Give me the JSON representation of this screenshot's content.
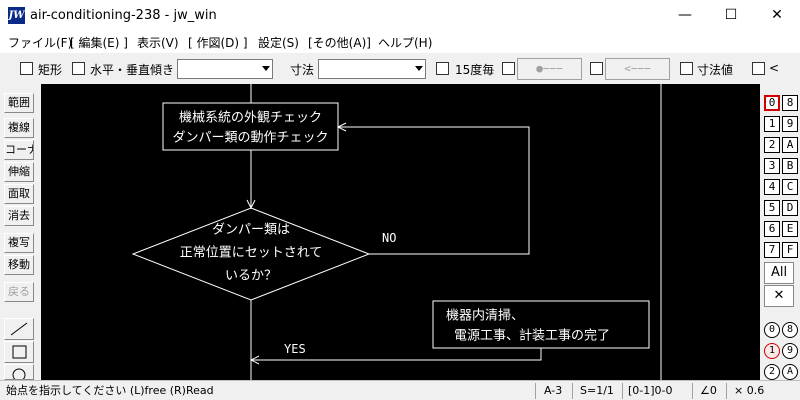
{
  "window": {
    "icon_text": "JW",
    "title": "air-conditioning-238 - jw_win",
    "minimize": "—",
    "maximize": "☐",
    "close": "✕"
  },
  "menu": [
    "ファイル(F)",
    "[ 編集(E) ]",
    "表示(V)",
    "[ 作図(D) ]",
    "設定(S)",
    "[その他(A)]",
    "ヘルプ(H)"
  ],
  "toolbar": {
    "rect": "矩形",
    "hv": "水平・垂直",
    "tilt": "傾き",
    "tilt_value": "",
    "dim": "寸法",
    "dim_value": "",
    "deg15": "15度毎",
    "pt_btn": "●−−−",
    "arrow_btn": "<−−−",
    "dimval": "寸法値",
    "lt": "<"
  },
  "left_tools": [
    "範囲",
    "複線",
    "コーナー",
    "伸縮",
    "面取",
    "消去",
    "複写",
    "移動",
    "戻る"
  ],
  "right_panel": {
    "layers_left": [
      "0",
      "1",
      "2",
      "3",
      "4",
      "5",
      "6",
      "7"
    ],
    "layers_right": [
      "8",
      "9",
      "A",
      "B",
      "C",
      "D",
      "E",
      "F"
    ],
    "all": "All",
    "x": "✕",
    "groups": [
      "0",
      "8",
      "1",
      "9",
      "2",
      "A"
    ]
  },
  "drawing": {
    "box1_line1": "機械系統の外観チェック",
    "box1_line2": "ダンパー類の動作チェック",
    "dec_line1": "ダンパー類は",
    "dec_line2": "正常位置にセットされて",
    "dec_line3": "いるか？",
    "no": "NO",
    "yes": "YES",
    "box2_line1": "機器内清掃、",
    "box2_line2": "電源工事、計装工事の完了"
  },
  "status": {
    "message": "始点を指示してください (L)free (R)Read",
    "paper": "A-3",
    "scale": "S=1/1",
    "layer": "[0-1]0-0",
    "angle": "∠0",
    "zoom": "× 0.6"
  }
}
